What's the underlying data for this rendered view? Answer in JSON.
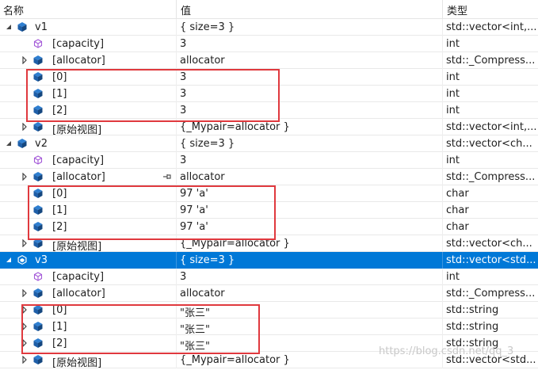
{
  "header": {
    "name": "名称",
    "value": "值",
    "type": "类型"
  },
  "rows": [
    {
      "name": "v1",
      "value": "{ size=3 }",
      "type": "std::vector<int,...",
      "depth": 0,
      "expander": "expanded",
      "icon": "object-icon"
    },
    {
      "name": "[capacity]",
      "value": "3",
      "type": "int",
      "depth": 1,
      "expander": "none",
      "icon": "property-icon"
    },
    {
      "name": "[allocator]",
      "value": "allocator",
      "type": "std::_Compress...",
      "depth": 1,
      "expander": "collapsed",
      "icon": "object-icon"
    },
    {
      "name": "[0]",
      "value": "3",
      "type": "int",
      "depth": 1,
      "expander": "none",
      "icon": "object-icon"
    },
    {
      "name": "[1]",
      "value": "3",
      "type": "int",
      "depth": 1,
      "expander": "none",
      "icon": "object-icon"
    },
    {
      "name": "[2]",
      "value": "3",
      "type": "int",
      "depth": 1,
      "expander": "none",
      "icon": "object-icon"
    },
    {
      "name": "[原始视图]",
      "value": "{_Mypair=allocator }",
      "type": "std::vector<int,...",
      "depth": 1,
      "expander": "collapsed",
      "icon": "object-icon"
    },
    {
      "name": "v2",
      "value": "{ size=3 }",
      "type": "std::vector<ch...",
      "depth": 0,
      "expander": "expanded",
      "icon": "object-icon"
    },
    {
      "name": "[capacity]",
      "value": "3",
      "type": "int",
      "depth": 1,
      "expander": "none",
      "icon": "property-icon"
    },
    {
      "name": "[allocator]",
      "value": "allocator",
      "type": "std::_Compress...",
      "depth": 1,
      "expander": "collapsed",
      "icon": "object-icon",
      "pin": true
    },
    {
      "name": "[0]",
      "value": "97 'a'",
      "type": "char",
      "depth": 1,
      "expander": "none",
      "icon": "object-icon"
    },
    {
      "name": "[1]",
      "value": "97 'a'",
      "type": "char",
      "depth": 1,
      "expander": "none",
      "icon": "object-icon"
    },
    {
      "name": "[2]",
      "value": "97 'a'",
      "type": "char",
      "depth": 1,
      "expander": "none",
      "icon": "object-icon"
    },
    {
      "name": "[原始视图]",
      "value": "{_Mypair=allocator }",
      "type": "std::vector<ch...",
      "depth": 1,
      "expander": "collapsed",
      "icon": "object-icon"
    },
    {
      "name": "v3",
      "value": "{ size=3 }",
      "type": "std::vector<std...",
      "depth": 0,
      "expander": "expanded",
      "icon": "object-icon",
      "selected": true
    },
    {
      "name": "[capacity]",
      "value": "3",
      "type": "int",
      "depth": 1,
      "expander": "none",
      "icon": "property-icon"
    },
    {
      "name": "[allocator]",
      "value": "allocator",
      "type": "std::_Compress...",
      "depth": 1,
      "expander": "collapsed",
      "icon": "object-icon"
    },
    {
      "name": "[0]",
      "value": "\"张三\"",
      "type": "std::string",
      "depth": 1,
      "expander": "collapsed",
      "icon": "object-icon"
    },
    {
      "name": "[1]",
      "value": "\"张三\"",
      "type": "std::string",
      "depth": 1,
      "expander": "collapsed",
      "icon": "object-icon"
    },
    {
      "name": "[2]",
      "value": "\"张三\"",
      "type": "std::string",
      "depth": 1,
      "expander": "collapsed",
      "icon": "object-icon"
    },
    {
      "name": "[原始视图]",
      "value": "{_Mypair=allocator }",
      "type": "std::vector<std...",
      "depth": 1,
      "expander": "collapsed",
      "icon": "object-icon"
    }
  ],
  "watermark": "https://blog.csdn.net/qq_3",
  "colors": {
    "selection": "#0078d7",
    "highlight_box": "#e0393e",
    "object_icon": "#1f5fa8",
    "property_icon": "#a45ad8"
  }
}
